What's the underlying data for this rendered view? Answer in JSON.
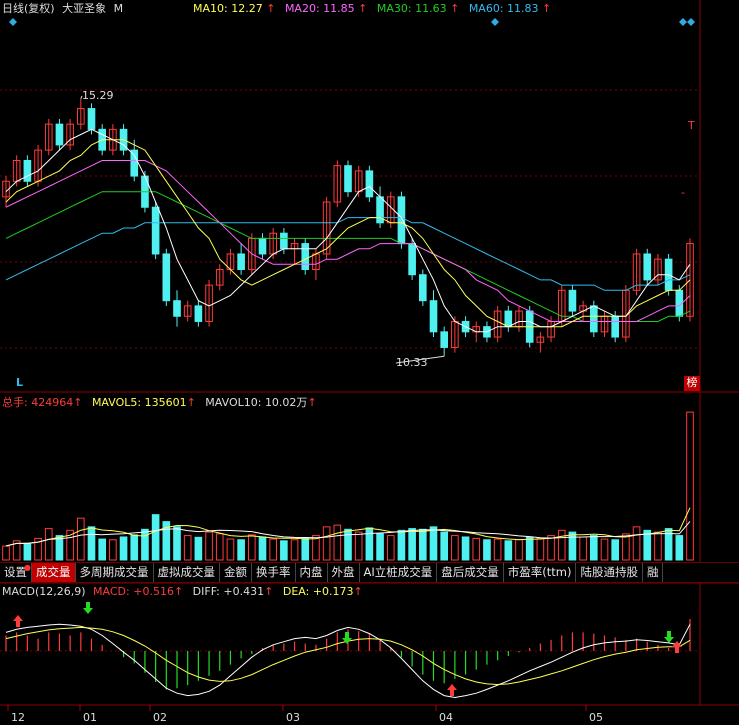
{
  "header": {
    "period": "日线(复权)",
    "stock_name": "大亚圣象",
    "stock_ma_prefix": "M",
    "ma10": {
      "label": "MA10:",
      "value": "12.27",
      "arrow": "↑",
      "color": "#ffff55"
    },
    "ma20": {
      "label": "MA20:",
      "value": "11.85",
      "arrow": "↑",
      "color": "#ff66ff"
    },
    "ma30": {
      "label": "MA30:",
      "value": "11.63",
      "arrow": "↑",
      "color": "#22cc22"
    },
    "ma60": {
      "label": "MA60:",
      "value": "11.83",
      "arrow": "↑",
      "color": "#33bbee"
    }
  },
  "price_panel": {
    "high_label": "15.29",
    "low_label": "10.33",
    "left_marker": "L",
    "right_badge": "榜",
    "right_marks": [
      "T",
      "-"
    ]
  },
  "volume_panel": {
    "total": {
      "label": "总手:",
      "value": "424964",
      "arrow": "↑"
    },
    "mavol5": {
      "label": "MAVOL5:",
      "value": "135601",
      "arrow": "↑"
    },
    "mavol10": {
      "label": "MAVOL10:",
      "value": "10.02万",
      "arrow": "↑"
    }
  },
  "tabs": [
    {
      "label": "设置",
      "active": false,
      "dot": true
    },
    {
      "label": "成交量",
      "active": true,
      "dot": false
    },
    {
      "label": "多周期成交量",
      "active": false,
      "dot": false
    },
    {
      "label": "虚拟成交量",
      "active": false,
      "dot": false
    },
    {
      "label": "金额",
      "active": false,
      "dot": false
    },
    {
      "label": "换手率",
      "active": false,
      "dot": false
    },
    {
      "label": "内盘",
      "active": false,
      "dot": false
    },
    {
      "label": "外盘",
      "active": false,
      "dot": false
    },
    {
      "label": "AI立桩成交量",
      "active": false,
      "dot": false
    },
    {
      "label": "盘后成交量",
      "active": false,
      "dot": false
    },
    {
      "label": "市盈率(ttm)",
      "active": false,
      "dot": false
    },
    {
      "label": "陆股通持股",
      "active": false,
      "dot": false
    },
    {
      "label": "融",
      "active": false,
      "dot": false
    }
  ],
  "macd_panel": {
    "name": "MACD(12,26,9)",
    "macd": {
      "label": "MACD:",
      "value": "+0.516",
      "arrow": "↑"
    },
    "diff": {
      "label": "DIFF:",
      "value": "+0.431",
      "arrow": "↑"
    },
    "dea": {
      "label": "DEA:",
      "value": "+0.173",
      "arrow": "↑"
    }
  },
  "colors": {
    "up": "#ff3b3b",
    "down": "#4ff0f0",
    "grid": "#7a0000",
    "ma5": "#ffffff"
  },
  "chart_data": {
    "type": "candlestick",
    "x_ticks": [
      "12",
      "01",
      "02",
      "03",
      "04",
      "05"
    ],
    "price_high": 15.29,
    "price_low": 10.33,
    "candles": [
      [
        13.4,
        13.8,
        13.2,
        13.7
      ],
      [
        13.7,
        14.2,
        13.6,
        14.1
      ],
      [
        14.1,
        14.2,
        13.6,
        13.7
      ],
      [
        13.7,
        14.4,
        13.6,
        14.3
      ],
      [
        14.3,
        14.9,
        14.2,
        14.8
      ],
      [
        14.8,
        14.9,
        14.3,
        14.4
      ],
      [
        14.4,
        14.9,
        14.3,
        14.8
      ],
      [
        14.8,
        15.29,
        14.7,
        15.1
      ],
      [
        15.1,
        15.2,
        14.6,
        14.7
      ],
      [
        14.7,
        14.8,
        14.2,
        14.3
      ],
      [
        14.3,
        14.8,
        14.2,
        14.7
      ],
      [
        14.7,
        14.8,
        14.2,
        14.3
      ],
      [
        14.3,
        14.5,
        13.7,
        13.8
      ],
      [
        13.8,
        13.9,
        13.1,
        13.2
      ],
      [
        13.2,
        13.3,
        12.2,
        12.3
      ],
      [
        12.3,
        12.4,
        11.3,
        11.4
      ],
      [
        11.4,
        11.6,
        10.9,
        11.1
      ],
      [
        11.1,
        11.4,
        11.0,
        11.3
      ],
      [
        11.3,
        11.4,
        10.9,
        11.0
      ],
      [
        11.0,
        11.8,
        10.9,
        11.7
      ],
      [
        11.7,
        12.1,
        11.6,
        12.0
      ],
      [
        12.0,
        12.4,
        11.9,
        12.3
      ],
      [
        12.3,
        12.5,
        11.9,
        12.0
      ],
      [
        12.0,
        12.7,
        11.9,
        12.6
      ],
      [
        12.6,
        12.7,
        12.2,
        12.3
      ],
      [
        12.3,
        12.8,
        12.2,
        12.7
      ],
      [
        12.7,
        12.8,
        12.3,
        12.4
      ],
      [
        12.4,
        12.6,
        12.1,
        12.5
      ],
      [
        12.5,
        12.6,
        11.9,
        12.0
      ],
      [
        12.0,
        12.4,
        11.8,
        12.3
      ],
      [
        12.3,
        13.4,
        12.2,
        13.3
      ],
      [
        13.3,
        14.1,
        13.2,
        14.0
      ],
      [
        14.0,
        14.1,
        13.4,
        13.5
      ],
      [
        13.5,
        14.0,
        13.4,
        13.9
      ],
      [
        13.9,
        14.0,
        13.3,
        13.4
      ],
      [
        13.4,
        13.6,
        12.8,
        12.9
      ],
      [
        12.9,
        13.5,
        12.8,
        13.4
      ],
      [
        13.4,
        13.5,
        12.4,
        12.5
      ],
      [
        12.5,
        12.6,
        11.8,
        11.9
      ],
      [
        11.9,
        12.0,
        11.3,
        11.4
      ],
      [
        11.4,
        11.6,
        10.7,
        10.8
      ],
      [
        10.8,
        10.9,
        10.33,
        10.5
      ],
      [
        10.5,
        11.1,
        10.4,
        11.0
      ],
      [
        11.0,
        11.1,
        10.7,
        10.8
      ],
      [
        10.8,
        11.0,
        10.6,
        10.9
      ],
      [
        10.9,
        11.0,
        10.6,
        10.7
      ],
      [
        10.7,
        11.3,
        10.6,
        11.2
      ],
      [
        11.2,
        11.3,
        10.8,
        10.9
      ],
      [
        10.9,
        11.3,
        10.8,
        11.2
      ],
      [
        11.2,
        11.3,
        10.5,
        10.6
      ],
      [
        10.6,
        10.8,
        10.4,
        10.7
      ],
      [
        10.7,
        11.1,
        10.6,
        11.0
      ],
      [
        11.0,
        11.7,
        10.9,
        11.6
      ],
      [
        11.6,
        11.7,
        11.1,
        11.2
      ],
      [
        11.2,
        11.4,
        11.0,
        11.3
      ],
      [
        11.3,
        11.4,
        10.7,
        10.8
      ],
      [
        10.8,
        11.2,
        10.7,
        11.1
      ],
      [
        11.1,
        11.2,
        10.6,
        10.7
      ],
      [
        10.7,
        11.7,
        10.6,
        11.6
      ],
      [
        11.6,
        12.4,
        11.5,
        12.3
      ],
      [
        12.3,
        12.4,
        11.7,
        11.8
      ],
      [
        11.8,
        12.3,
        11.7,
        12.2
      ],
      [
        12.2,
        12.3,
        11.5,
        11.6
      ],
      [
        11.6,
        11.7,
        11.0,
        11.1
      ],
      [
        11.1,
        12.6,
        11.0,
        12.5
      ]
    ],
    "volume": [
      40,
      55,
      48,
      62,
      90,
      70,
      85,
      120,
      95,
      60,
      58,
      66,
      72,
      88,
      130,
      110,
      95,
      70,
      65,
      80,
      75,
      60,
      58,
      72,
      66,
      60,
      55,
      58,
      62,
      70,
      95,
      100,
      88,
      80,
      92,
      75,
      70,
      85,
      90,
      88,
      95,
      80,
      70,
      66,
      62,
      58,
      60,
      55,
      58,
      66,
      62,
      70,
      85,
      80,
      66,
      70,
      60,
      58,
      75,
      95,
      85,
      80,
      90,
      70,
      424
    ],
    "ma5": [
      13.5,
      13.7,
      13.8,
      13.9,
      14.1,
      14.3,
      14.5,
      14.6,
      14.7,
      14.6,
      14.5,
      14.4,
      14.2,
      13.8,
      13.3,
      12.8,
      12.2,
      11.8,
      11.4,
      11.3,
      11.4,
      11.5,
      11.7,
      11.9,
      12.1,
      12.3,
      12.4,
      12.4,
      12.4,
      12.4,
      12.6,
      12.9,
      13.2,
      13.5,
      13.6,
      13.4,
      13.2,
      13.0,
      12.6,
      12.2,
      11.8,
      11.3,
      11.0,
      10.9,
      10.8,
      10.8,
      10.9,
      10.9,
      11.0,
      11.0,
      10.9,
      10.9,
      11.0,
      11.1,
      11.2,
      11.3,
      11.2,
      11.1,
      11.1,
      11.4,
      11.7,
      11.9,
      11.9,
      11.8,
      12.1
    ],
    "ma10": [
      13.3,
      13.5,
      13.6,
      13.7,
      13.8,
      13.9,
      14.1,
      14.2,
      14.4,
      14.5,
      14.5,
      14.5,
      14.4,
      14.3,
      14.0,
      13.7,
      13.4,
      13.1,
      12.8,
      12.6,
      12.2,
      12.0,
      11.8,
      11.7,
      11.8,
      11.9,
      12.0,
      12.1,
      12.2,
      12.3,
      12.4,
      12.6,
      12.8,
      12.9,
      13.0,
      13.0,
      12.9,
      12.9,
      12.8,
      12.6,
      12.3,
      12.0,
      11.8,
      11.5,
      11.3,
      11.1,
      11.0,
      10.9,
      10.9,
      10.9,
      10.9,
      10.9,
      10.9,
      11.0,
      11.1,
      11.1,
      11.1,
      11.1,
      11.1,
      11.3,
      11.4,
      11.5,
      11.6,
      11.6,
      11.8
    ],
    "ma20": [
      13.2,
      13.3,
      13.4,
      13.5,
      13.6,
      13.7,
      13.8,
      13.9,
      14.0,
      14.1,
      14.1,
      14.1,
      14.1,
      14.1,
      14.0,
      13.9,
      13.7,
      13.5,
      13.3,
      13.1,
      12.9,
      12.7,
      12.5,
      12.3,
      12.2,
      12.1,
      12.1,
      12.1,
      12.1,
      12.1,
      12.2,
      12.2,
      12.3,
      12.4,
      12.4,
      12.5,
      12.5,
      12.5,
      12.5,
      12.4,
      12.3,
      12.2,
      12.1,
      12.0,
      11.8,
      11.7,
      11.6,
      11.4,
      11.3,
      11.2,
      11.1,
      11.0,
      11.0,
      11.0,
      11.0,
      11.0,
      11.0,
      11.0,
      11.0,
      11.0,
      11.1,
      11.2,
      11.3,
      11.3,
      11.5
    ],
    "ma30": [
      12.6,
      12.7,
      12.8,
      12.9,
      13.0,
      13.1,
      13.2,
      13.3,
      13.4,
      13.5,
      13.5,
      13.5,
      13.5,
      13.5,
      13.5,
      13.4,
      13.3,
      13.2,
      13.1,
      13.0,
      12.9,
      12.8,
      12.7,
      12.6,
      12.6,
      12.6,
      12.6,
      12.6,
      12.6,
      12.6,
      12.6,
      12.6,
      12.6,
      12.6,
      12.6,
      12.6,
      12.6,
      12.5,
      12.5,
      12.4,
      12.3,
      12.2,
      12.1,
      12.0,
      11.9,
      11.8,
      11.7,
      11.6,
      11.5,
      11.4,
      11.3,
      11.2,
      11.1,
      11.1,
      11.0,
      11.0,
      11.0,
      11.0,
      11.0,
      11.0,
      11.0,
      11.0,
      11.1,
      11.1,
      11.2
    ],
    "ma60": [
      11.8,
      11.9,
      12.0,
      12.1,
      12.2,
      12.3,
      12.4,
      12.5,
      12.6,
      12.7,
      12.7,
      12.8,
      12.8,
      12.9,
      12.9,
      12.9,
      12.9,
      12.9,
      12.9,
      12.9,
      12.9,
      12.9,
      12.9,
      12.9,
      12.9,
      12.9,
      12.9,
      12.9,
      12.9,
      12.9,
      12.9,
      12.9,
      13.0,
      13.0,
      13.0,
      13.0,
      13.0,
      13.0,
      12.9,
      12.9,
      12.8,
      12.7,
      12.6,
      12.5,
      12.4,
      12.3,
      12.2,
      12.1,
      12.0,
      11.9,
      11.8,
      11.8,
      11.7,
      11.7,
      11.7,
      11.7,
      11.6,
      11.6,
      11.6,
      11.7,
      11.7,
      11.7,
      11.8,
      11.8,
      11.9
    ],
    "macd_hist": [
      0.25,
      0.3,
      0.25,
      0.2,
      0.3,
      0.28,
      0.25,
      0.3,
      0.2,
      0.1,
      0.0,
      -0.1,
      -0.2,
      -0.35,
      -0.5,
      -0.62,
      -0.6,
      -0.55,
      -0.48,
      -0.4,
      -0.32,
      -0.22,
      -0.12,
      -0.05,
      0.05,
      0.1,
      0.12,
      0.15,
      0.12,
      0.1,
      0.2,
      0.3,
      0.35,
      0.32,
      0.28,
      0.2,
      0.05,
      -0.1,
      -0.25,
      -0.38,
      -0.48,
      -0.52,
      -0.45,
      -0.38,
      -0.3,
      -0.22,
      -0.15,
      -0.08,
      -0.02,
      0.05,
      0.12,
      0.18,
      0.25,
      0.3,
      0.3,
      0.28,
      0.25,
      0.22,
      0.18,
      0.2,
      0.15,
      0.1,
      0.05,
      0.0,
      0.516
    ],
    "diff": [
      0.3,
      0.35,
      0.38,
      0.4,
      0.42,
      0.43,
      0.42,
      0.4,
      0.35,
      0.25,
      0.12,
      -0.02,
      -0.15,
      -0.3,
      -0.45,
      -0.6,
      -0.68,
      -0.72,
      -0.7,
      -0.65,
      -0.55,
      -0.4,
      -0.25,
      -0.1,
      0.02,
      0.1,
      0.15,
      0.2,
      0.22,
      0.2,
      0.25,
      0.33,
      0.38,
      0.35,
      0.28,
      0.18,
      0.05,
      -0.12,
      -0.3,
      -0.48,
      -0.62,
      -0.72,
      -0.75,
      -0.72,
      -0.68,
      -0.62,
      -0.55,
      -0.48,
      -0.4,
      -0.32,
      -0.25,
      -0.18,
      -0.1,
      -0.02,
      0.05,
      0.1,
      0.13,
      0.15,
      0.16,
      0.18,
      0.17,
      0.15,
      0.13,
      0.1,
      0.431
    ],
    "dea": [
      0.2,
      0.24,
      0.28,
      0.31,
      0.34,
      0.36,
      0.37,
      0.38,
      0.37,
      0.35,
      0.31,
      0.25,
      0.17,
      0.08,
      -0.03,
      -0.15,
      -0.25,
      -0.35,
      -0.42,
      -0.47,
      -0.49,
      -0.48,
      -0.44,
      -0.38,
      -0.3,
      -0.22,
      -0.15,
      -0.08,
      -0.02,
      0.02,
      0.06,
      0.12,
      0.16,
      0.19,
      0.2,
      0.19,
      0.16,
      0.1,
      0.02,
      -0.08,
      -0.2,
      -0.3,
      -0.38,
      -0.45,
      -0.5,
      -0.53,
      -0.54,
      -0.53,
      -0.5,
      -0.46,
      -0.42,
      -0.37,
      -0.32,
      -0.26,
      -0.2,
      -0.14,
      -0.09,
      -0.05,
      -0.02,
      0.02,
      0.04,
      0.06,
      0.07,
      0.07,
      0.173
    ]
  }
}
